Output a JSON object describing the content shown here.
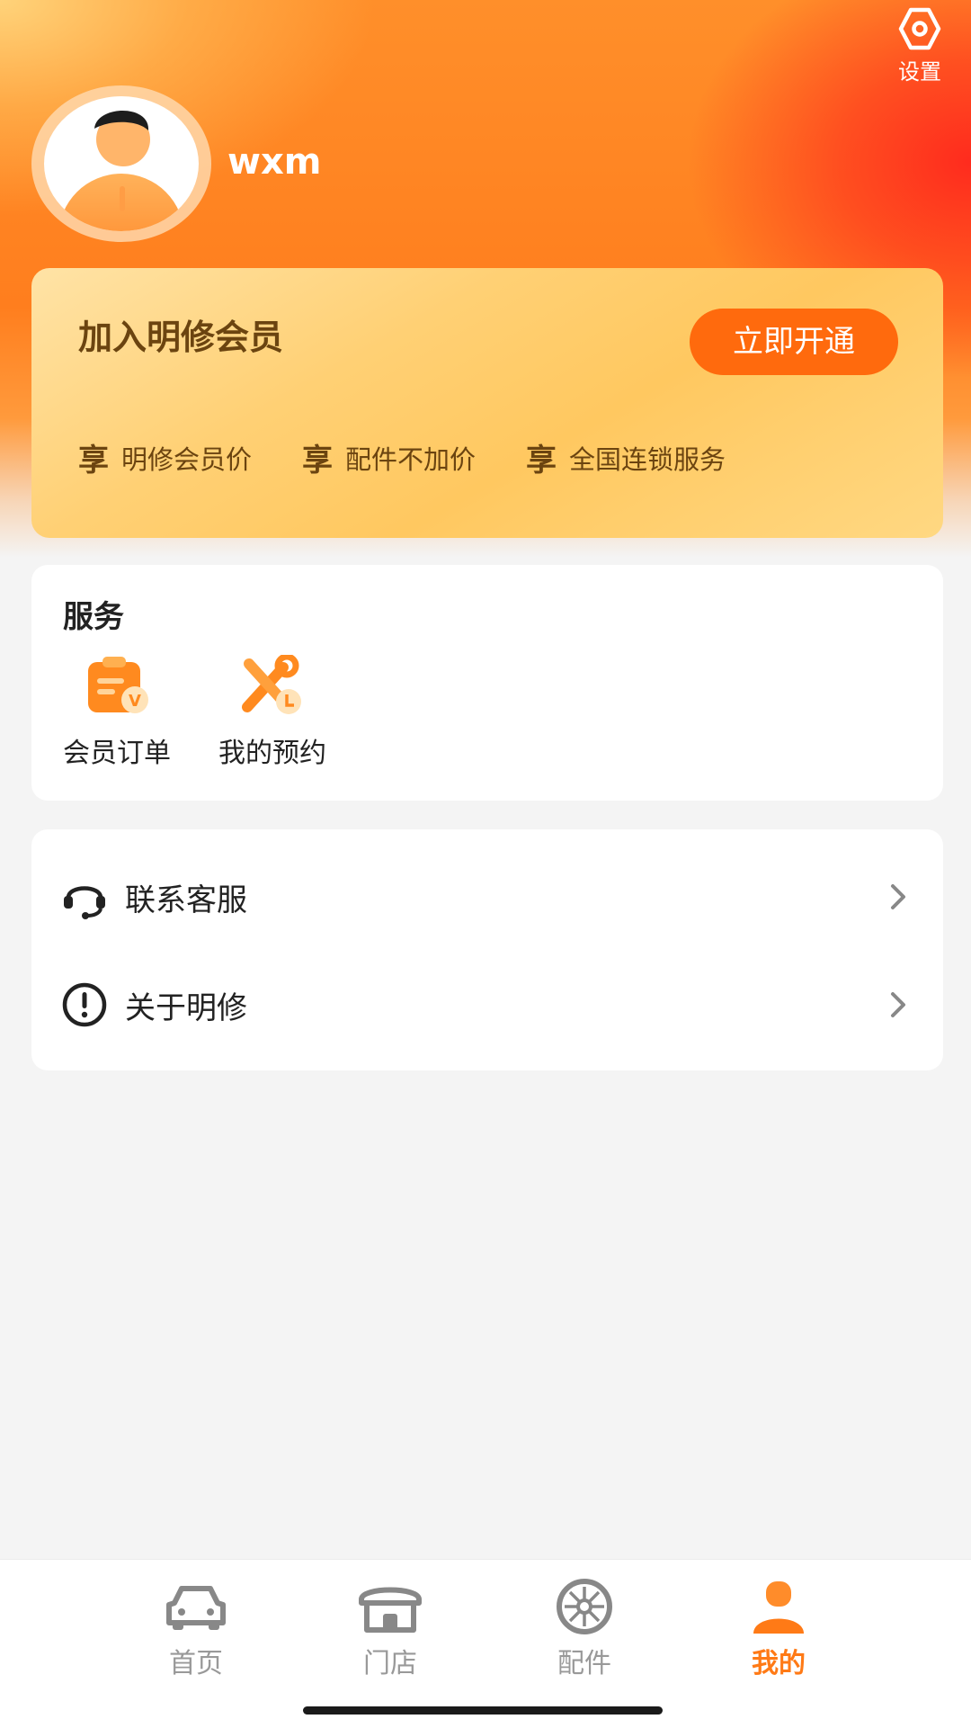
{
  "header": {
    "settings_label": "设置",
    "username": "wxm"
  },
  "member_card": {
    "title": "加入明修会员",
    "button_label": "立即开通",
    "perk_prefix": "享",
    "perks": [
      "明修会员价",
      "配件不加价",
      "全国连锁服务"
    ]
  },
  "services": {
    "title": "服务",
    "items": [
      {
        "label": "会员订单",
        "icon": "member-order-icon"
      },
      {
        "label": "我的预约",
        "icon": "appointment-icon"
      }
    ]
  },
  "menu": {
    "items": [
      {
        "label": "联系客服",
        "icon": "headset-icon"
      },
      {
        "label": "关于明修",
        "icon": "info-circle-icon"
      }
    ]
  },
  "tabbar": {
    "tabs": [
      {
        "label": "首页",
        "icon": "car-icon",
        "active": false
      },
      {
        "label": "门店",
        "icon": "store-icon",
        "active": false
      },
      {
        "label": "配件",
        "icon": "wheel-icon",
        "active": false
      },
      {
        "label": "我的",
        "icon": "person-icon",
        "active": true
      }
    ]
  },
  "colors": {
    "accent": "#ff6a0d",
    "brand_text": "#6b4410",
    "tab_active": "#ff7a16",
    "tab_inactive": "#999999"
  }
}
